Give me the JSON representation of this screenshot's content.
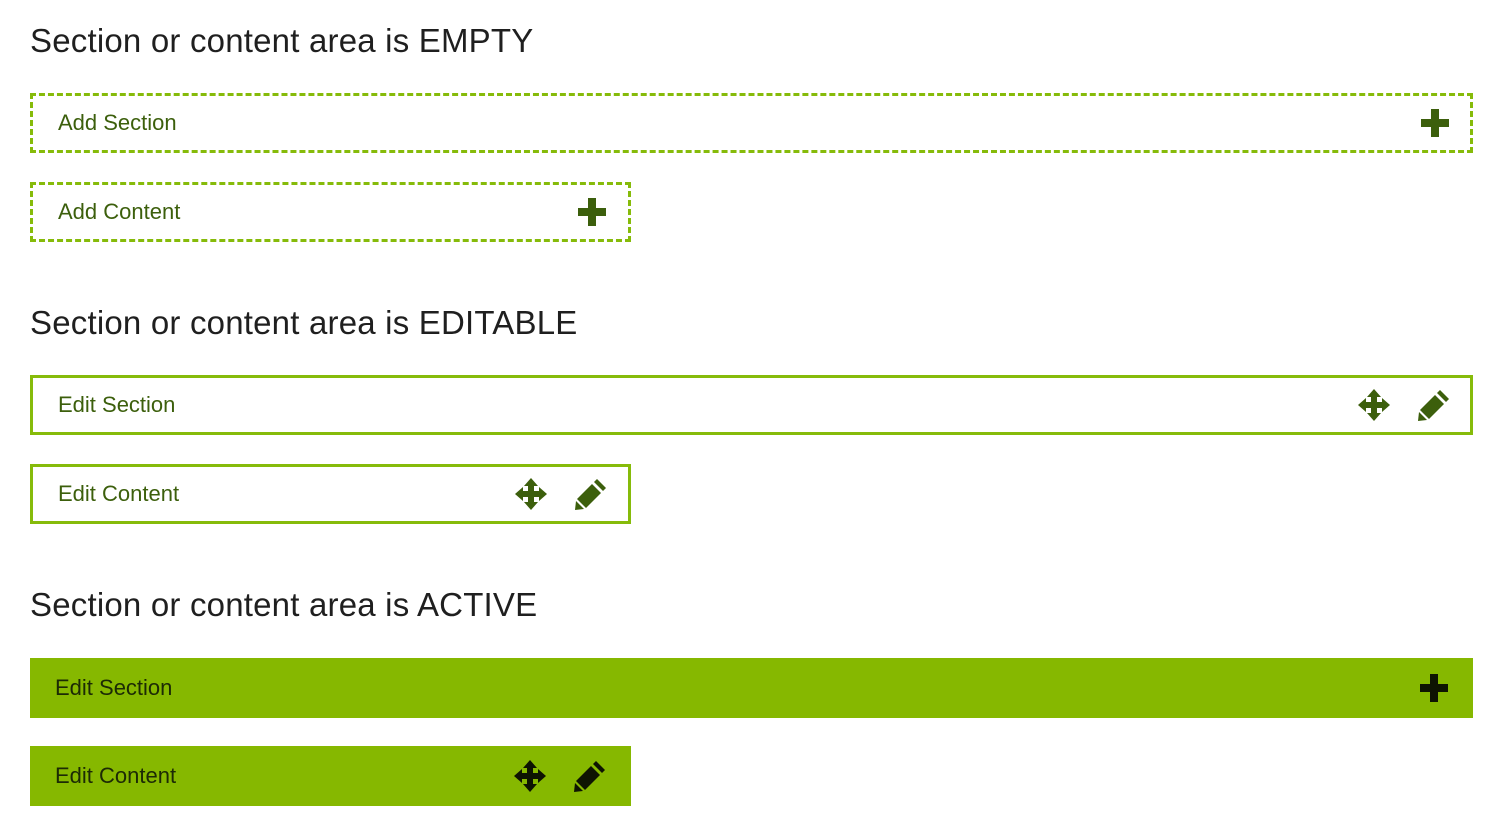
{
  "sections": [
    {
      "heading": "Section or content area is EMPTY",
      "section_bar": {
        "label": "Add Section",
        "icons": [
          "plus-icon"
        ]
      },
      "content_bar": {
        "label": "Add Content",
        "icons": [
          "plus-icon"
        ]
      }
    },
    {
      "heading": "Section or content area is EDITABLE",
      "section_bar": {
        "label": "Edit Section",
        "icons": [
          "move-icon",
          "pencil-icon"
        ]
      },
      "content_bar": {
        "label": "Edit Content",
        "icons": [
          "move-icon",
          "pencil-icon"
        ]
      }
    },
    {
      "heading": "Section or content area is ACTIVE",
      "section_bar": {
        "label": "Edit Section",
        "icons": [
          "plus-icon"
        ]
      },
      "content_bar": {
        "label": "Edit Content",
        "icons": [
          "move-icon",
          "pencil-icon"
        ]
      }
    }
  ],
  "colors": {
    "accent_green": "#86bb0a",
    "active_fill": "#86b800",
    "label_green": "#3c5f0c",
    "heading_text": "#1f1f1f"
  }
}
